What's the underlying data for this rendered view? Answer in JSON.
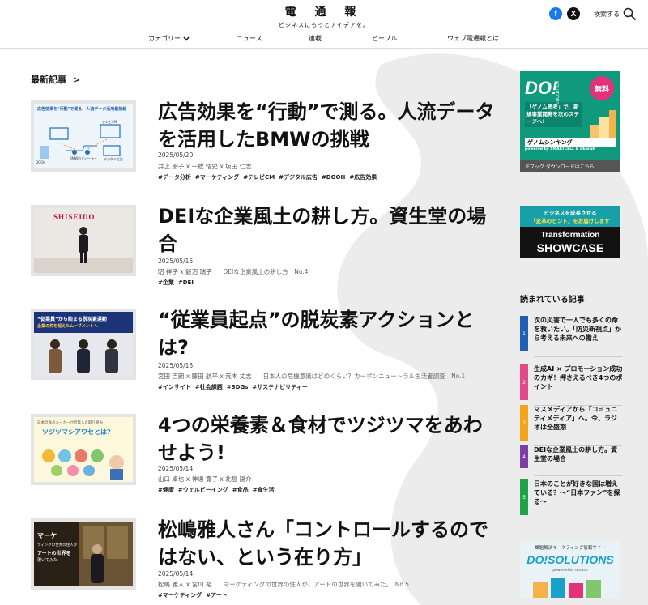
{
  "header": {
    "logo": "電 通 報",
    "tagline": "ビジネスにもっとアイデアを。",
    "search_label": "検索する",
    "social": [
      "facebook-icon",
      "x-icon"
    ],
    "nav": [
      "カテゴリー",
      "ニュース",
      "連載",
      "ピープル",
      "ウェブ電通報とは"
    ]
  },
  "main": {
    "section_title": "最新記事",
    "section_arrow": ">",
    "articles": [
      {
        "title": "広告効果を“行動”で測る。人流データを活用したBMWの挑戦",
        "date": "2025/05/20",
        "authors": "井上 朋子 x 一枚 悟史 x 坂田 仁志",
        "series": "",
        "tags": [
          "#データ分析",
          "#マーケティング",
          "#テレビCM",
          "#デジタル広告",
          "#DOOH",
          "#広告効果"
        ],
        "thumb_caption": "広告効果を\"行動\"で測る、人流データ活用最前線",
        "thumb_labels": [
          "DOOH",
          "BMWのディーラー",
          "テレビCM",
          "デジタル広告"
        ]
      },
      {
        "title": "DEIな企業風土の耕し方。資生堂の場合",
        "date": "2025/05/15",
        "authors": "昭 祥子 x 飯沼 瑞子",
        "series": "DEIな企業風土の耕し方　No.4",
        "tags": [
          "#企業",
          "#DEI"
        ],
        "thumb_caption": "SHISEIDO",
        "thumb_labels": []
      },
      {
        "title": "“従業員起点”の脱炭素アクションとは?",
        "date": "2025/05/15",
        "authors": "宮田 吉朗 x 藤田 航平 x 荒木 丈志",
        "series": "日本人の危機意識はどのくらい？カーボンニュートラル生活者調査　No.1",
        "tags": [
          "#インサイト",
          "#社会課題",
          "#SDGs",
          "#サステナビリティー"
        ],
        "thumb_caption": "“従業員”から始まる脱炭素運動",
        "thumb_labels": [
          "企業の枠を超えたムーブメントへ"
        ]
      },
      {
        "title": "4つの栄養素＆食材でツジツマをあわせよう!",
        "date": "2025/05/14",
        "authors": "山口 卓也 x 神通 寛子 x 北島 陽介",
        "series": "",
        "tags": [
          "#健康",
          "#ウェルビーイング",
          "#食品",
          "#食生活"
        ],
        "thumb_caption": "ツジツマシアワセとは?",
        "thumb_labels": [
          "日本の食品メーカーが結集した取り組み"
        ]
      },
      {
        "title": "松嶋雅人さん「コントロールするのではない、という在り方」",
        "date": "2025/05/14",
        "authors": "松嶋 雅人 x 宮川 裕",
        "series": "マーケティングの世界の住人が、アートの世界を覗いてみた。　No.5",
        "tags": [
          "#マーケティング",
          "#アート"
        ],
        "thumb_caption": "マーケ",
        "thumb_labels": [
          "ティングの世界の住人が",
          "アートの世界を",
          "覗いてみた"
        ]
      }
    ]
  },
  "sidebar": {
    "ad1": {
      "logo": "DO!",
      "logo_sub": "SOLUTIONS",
      "badge": "無料",
      "copy": "「ゲノム思考」で、新規事業開発を次のステージへ!",
      "product": "ゲノムシンキング",
      "powered": "powered by SMARTCELL & DESIGN",
      "cta": "Eブック ダウンロードはこちら"
    },
    "ad2": {
      "line1": "ビジネスを成長させる",
      "line2": "「変革のヒント」をお届けします",
      "brand1": "Transformation",
      "brand2": "SHOWCASE"
    },
    "ranking_title": "読まれている記事",
    "ranking": [
      {
        "rank": "1",
        "text": "次の災害で一人でも多くの命を救いたい。「防災新視点」から考える未来への備え",
        "color": "#1f5fb4"
      },
      {
        "rank": "2",
        "text": "生成AI × プロモーション成功のカギ！押さえるべき4つのポイント",
        "color": "#e24a8a"
      },
      {
        "rank": "3",
        "text": "マスメディアから「コミュニティメディア」へ。今、ラジオは全盛期",
        "color": "#f5a31a"
      },
      {
        "rank": "4",
        "text": "DEIな企業風土の耕し方。資生堂の場合",
        "color": "#7b3fa6"
      },
      {
        "rank": "5",
        "text": "日本のことが好きな国は増えている？〜“日本ファン”を探る〜",
        "color": "#1fa24a"
      }
    ],
    "ad3": {
      "top": "課題解決マーケティング情報サイト",
      "logo": "DO!SOLUTIONS",
      "sub": "powered by dentsu"
    }
  }
}
